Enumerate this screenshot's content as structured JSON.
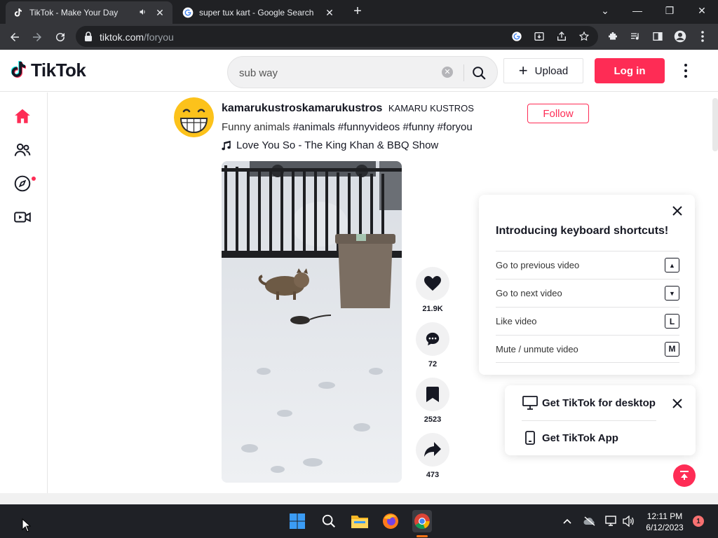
{
  "browser": {
    "tabs": [
      {
        "title": "TikTok - Make Your Day",
        "active": true
      },
      {
        "title": "super tux kart - Google Search",
        "active": false
      }
    ],
    "url_host": "tiktok.com",
    "url_path": "/foryou"
  },
  "tiktok": {
    "logo_text": "TikTok",
    "search_value": "sub way",
    "upload_label": "Upload",
    "login_label": "Log in"
  },
  "post": {
    "username": "kamarukustroskamarukustros",
    "nickname": "KAMARU KUSTROS",
    "follow_label": "Follow",
    "caption_text": "Funny animals",
    "hashtags": "#animals #funnyvideos #funny #foryou",
    "music": "Love You So - The King Khan & BBQ Show",
    "likes": "21.9K",
    "comments": "72",
    "saves": "2523",
    "shares": "473"
  },
  "shortcuts": {
    "title": "Introducing keyboard shortcuts!",
    "items": [
      {
        "label": "Go to previous video",
        "key": "▲"
      },
      {
        "label": "Go to next video",
        "key": "▼"
      },
      {
        "label": "Like video",
        "key": "L"
      },
      {
        "label": "Mute / unmute video",
        "key": "M"
      }
    ]
  },
  "get_app": {
    "desktop_label": "Get TikTok for desktop",
    "app_label": "Get TikTok App"
  },
  "taskbar": {
    "time": "12:11 PM",
    "date": "6/12/2023",
    "notifications": "1"
  },
  "colors": {
    "brand": "#fe2c55",
    "browser_dark": "#202124",
    "taskbar": "#1f2126"
  }
}
